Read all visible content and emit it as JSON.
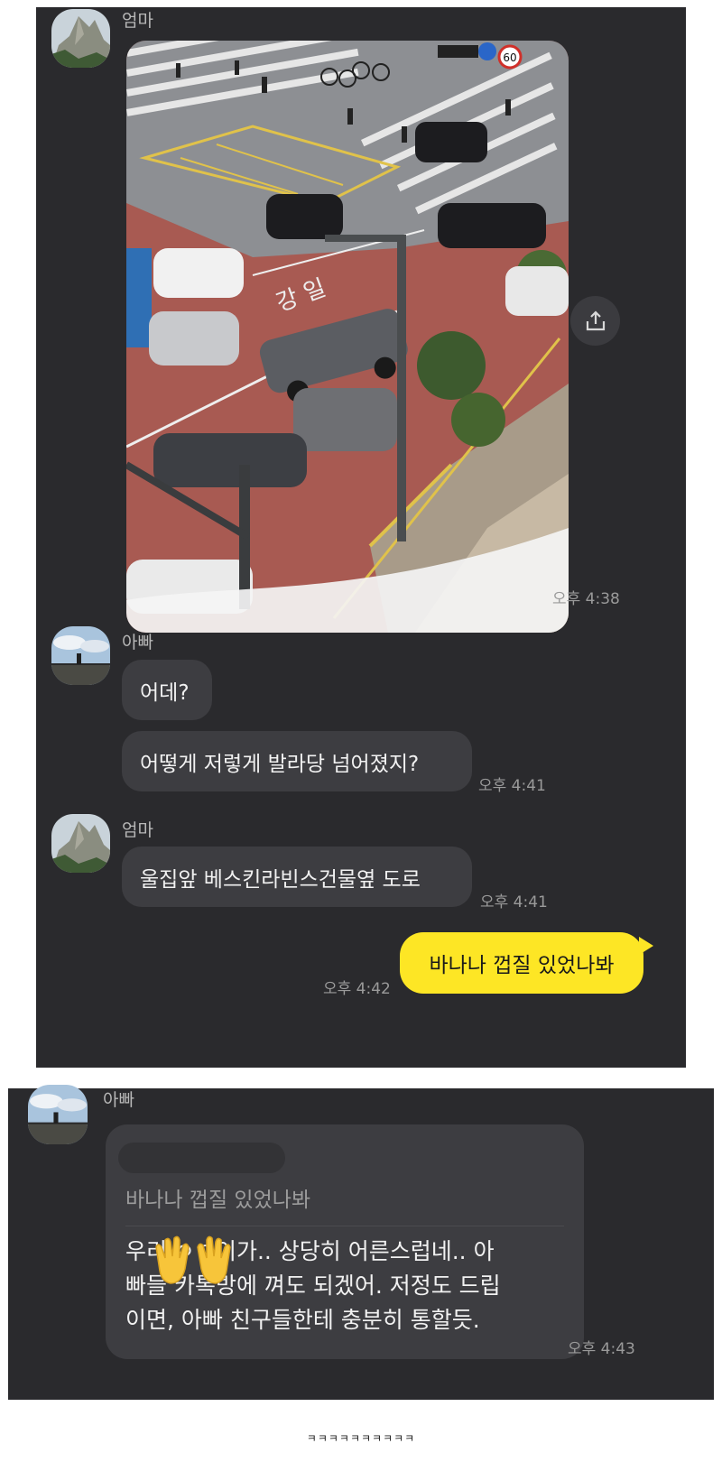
{
  "chat1": {
    "msg1": {
      "sender": "엄마",
      "photo_time": "오후 4:38"
    },
    "msg2": {
      "sender": "아빠",
      "bubble1": "어데?",
      "bubble2": "어떻게 저렇게 발라당 넘어졌지?",
      "time": "오후 4:41"
    },
    "msg3": {
      "sender": "엄마",
      "bubble": "울집앞 베스킨라빈스건물옆 도로",
      "time": "오후 4:41"
    },
    "msg4": {
      "mine": "바나나 껍질 있었나봐",
      "time": "오후 4:42"
    },
    "photo": {
      "speed_sign": "60",
      "road_marking": "강 일"
    }
  },
  "chat2": {
    "sender": "아빠",
    "reply_quote": "바나나 껍질 있었나봐",
    "reply_lines": [
      "우리 ㅇㅇ이가.. 상당히 어른스럽네.. 아",
      "빠들 카톡방에 껴도 되겠어. 저정도 드립",
      "이면, 아빠 친구들한테 충분히 통할듯."
    ],
    "time": "오후 4:43"
  },
  "footer": "ㅋㅋㅋㅋㅋㅋㅋㅋㅋㅋ",
  "colors": {
    "panel_bg": "#2a2a2d",
    "bubble_bg": "#3d3d41",
    "mine_bubble": "#fde625"
  },
  "icons": {
    "share": "share-icon",
    "emoji": "raising-hands-emoji"
  }
}
